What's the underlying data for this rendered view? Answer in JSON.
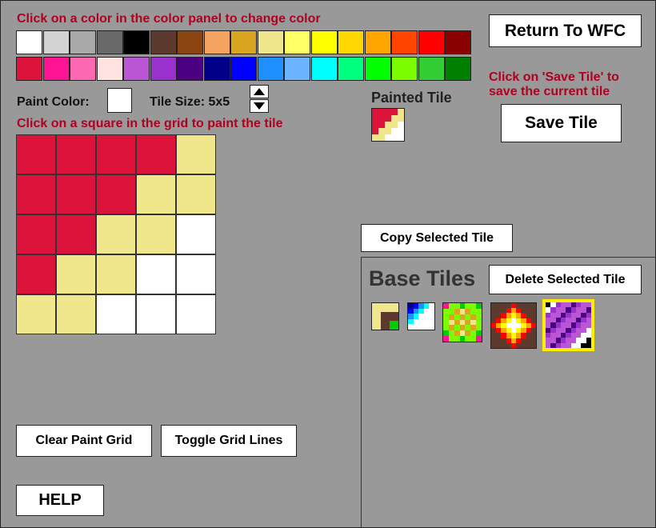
{
  "instructions": {
    "color_panel": "Click on a color in the color panel to change color",
    "grid": "Click on a square in the grid to paint the tile",
    "save": "Click on 'Save Tile' to save the current tile"
  },
  "buttons": {
    "return": "Return To WFC",
    "save_tile": "Save Tile",
    "copy_selected": "Copy Selected Tile",
    "delete_selected": "Delete Selected Tile",
    "clear_grid": "Clear Paint Grid",
    "toggle_grid": "Toggle Grid Lines",
    "help": "HELP"
  },
  "paint_color_label": "Paint Color:",
  "paint_color": "#ffffff",
  "tile_size_label": "Tile Size: 5x5",
  "painted_tile_label": "Painted Tile",
  "base_tiles_label": "Base Tiles",
  "palette_row1": [
    "#ffffff",
    "#d3d3d3",
    "#a9a9a9",
    "#696969",
    "#000000",
    "#5c3a2e",
    "#8b4513",
    "#f4a460",
    "#daa520",
    "#f0e68c",
    "#ffff66",
    "#ffff00",
    "#ffd700",
    "#ffa500",
    "#ff4500",
    "#ff0000",
    "#8b0000"
  ],
  "palette_row2": [
    "#dc143c",
    "#ff1493",
    "#ff69b4",
    "#ffe4e1",
    "#ba55d3",
    "#9932cc",
    "#4b0082",
    "#00008b",
    "#0000ff",
    "#1e90ff",
    "#6cb4ff",
    "#00ffff",
    "#00ff7f",
    "#00ff00",
    "#7cfc00",
    "#32cd32",
    "#008000"
  ],
  "grid": [
    [
      "#dc143c",
      "#dc143c",
      "#dc143c",
      "#dc143c",
      "#f0e68c"
    ],
    [
      "#dc143c",
      "#dc143c",
      "#dc143c",
      "#f0e68c",
      "#f0e68c"
    ],
    [
      "#dc143c",
      "#dc143c",
      "#f0e68c",
      "#f0e68c",
      "#ffffff"
    ],
    [
      "#dc143c",
      "#f0e68c",
      "#f0e68c",
      "#ffffff",
      "#ffffff"
    ],
    [
      "#f0e68c",
      "#f0e68c",
      "#ffffff",
      "#ffffff",
      "#ffffff"
    ]
  ],
  "base_tiles": [
    {
      "name": "tile-brown-green",
      "size": 3,
      "selected": false,
      "pixels": [
        "#f0e68c",
        "#f0e68c",
        "#f0e68c",
        "#f0e68c",
        "#5c3a2e",
        "#5c3a2e",
        "#f0e68c",
        "#5c3a2e",
        "#00cc00"
      ]
    },
    {
      "name": "tile-blue-gradient",
      "size": 5,
      "selected": false,
      "pixels": [
        "#00008b",
        "#0000ff",
        "#1e90ff",
        "#00ffff",
        "#ffffff",
        "#0000ff",
        "#1e90ff",
        "#00ffff",
        "#ffffff",
        "#ffffff",
        "#1e90ff",
        "#00ffff",
        "#ffffff",
        "#ffffff",
        "#ffffff",
        "#00ffff",
        "#ffffff",
        "#ffffff",
        "#ffffff",
        "#ffffff",
        "#ffffff",
        "#ffffff",
        "#ffffff",
        "#ffffff",
        "#ffffff"
      ]
    },
    {
      "name": "tile-green-pattern",
      "size": 7,
      "selected": false,
      "pixels": [
        "#ff1493",
        "#7cfc00",
        "#7cfc00",
        "#00cc00",
        "#7cfc00",
        "#7cfc00",
        "#00cc00",
        "#7cfc00",
        "#7cfc00",
        "#daa520",
        "#f0e68c",
        "#daa520",
        "#7cfc00",
        "#7cfc00",
        "#7cfc00",
        "#daa520",
        "#7cfc00",
        "#daa520",
        "#7cfc00",
        "#daa520",
        "#7cfc00",
        "#7cfc00",
        "#f0e68c",
        "#daa520",
        "#f0e68c",
        "#daa520",
        "#f0e68c",
        "#7cfc00",
        "#7cfc00",
        "#daa520",
        "#7cfc00",
        "#daa520",
        "#7cfc00",
        "#daa520",
        "#7cfc00",
        "#00cc00",
        "#7cfc00",
        "#daa520",
        "#f0e68c",
        "#daa520",
        "#7cfc00",
        "#00cc00",
        "#ff1493",
        "#7cfc00",
        "#7cfc00",
        "#00cc00",
        "#7cfc00",
        "#7cfc00",
        "#ff1493"
      ]
    },
    {
      "name": "tile-fire-diamond",
      "size": 9,
      "selected": false,
      "pixels": [
        "#5c3a2e",
        "#5c3a2e",
        "#5c3a2e",
        "#5c3a2e",
        "#ff0000",
        "#5c3a2e",
        "#5c3a2e",
        "#5c3a2e",
        "#5c3a2e",
        "#5c3a2e",
        "#5c3a2e",
        "#5c3a2e",
        "#ff0000",
        "#ffa500",
        "#ff0000",
        "#5c3a2e",
        "#5c3a2e",
        "#5c3a2e",
        "#5c3a2e",
        "#5c3a2e",
        "#ff0000",
        "#ffa500",
        "#ffff00",
        "#ffa500",
        "#ff0000",
        "#5c3a2e",
        "#5c3a2e",
        "#5c3a2e",
        "#ff0000",
        "#ffa500",
        "#ffff00",
        "#ffffff",
        "#ffff00",
        "#ffa500",
        "#ff0000",
        "#5c3a2e",
        "#ff0000",
        "#ffa500",
        "#ffff00",
        "#ffffff",
        "#ffffff",
        "#ffffff",
        "#ffff00",
        "#ffa500",
        "#ff0000",
        "#5c3a2e",
        "#ff0000",
        "#ffa500",
        "#ffff00",
        "#ffffff",
        "#ffff00",
        "#ffa500",
        "#ff0000",
        "#5c3a2e",
        "#5c3a2e",
        "#5c3a2e",
        "#ff0000",
        "#ffa500",
        "#ffff00",
        "#ffa500",
        "#ff0000",
        "#5c3a2e",
        "#5c3a2e",
        "#5c3a2e",
        "#5c3a2e",
        "#5c3a2e",
        "#ff0000",
        "#ffa500",
        "#ff0000",
        "#5c3a2e",
        "#5c3a2e",
        "#5c3a2e",
        "#5c3a2e",
        "#5c3a2e",
        "#5c3a2e",
        "#5c3a2e",
        "#ff0000",
        "#5c3a2e",
        "#5c3a2e",
        "#5c3a2e",
        "#5c3a2e"
      ]
    },
    {
      "name": "tile-purple-diagonal",
      "size": 9,
      "selected": true,
      "pixels": [
        "#000000",
        "#ffffff",
        "#9932cc",
        "#ba55d3",
        "#ba55d3",
        "#4b0082",
        "#9932cc",
        "#ba55d3",
        "#ba55d3",
        "#ffffff",
        "#9932cc",
        "#ba55d3",
        "#ba55d3",
        "#4b0082",
        "#9932cc",
        "#ba55d3",
        "#ba55d3",
        "#4b0082",
        "#9932cc",
        "#ba55d3",
        "#ba55d3",
        "#4b0082",
        "#9932cc",
        "#ba55d3",
        "#ba55d3",
        "#4b0082",
        "#9932cc",
        "#ba55d3",
        "#ba55d3",
        "#4b0082",
        "#9932cc",
        "#ba55d3",
        "#ba55d3",
        "#4b0082",
        "#9932cc",
        "#ba55d3",
        "#ba55d3",
        "#4b0082",
        "#9932cc",
        "#ba55d3",
        "#ba55d3",
        "#4b0082",
        "#9932cc",
        "#ba55d3",
        "#ba55d3",
        "#4b0082",
        "#9932cc",
        "#ba55d3",
        "#ba55d3",
        "#4b0082",
        "#9932cc",
        "#ba55d3",
        "#ba55d3",
        "#ffffff",
        "#9932cc",
        "#ba55d3",
        "#ba55d3",
        "#4b0082",
        "#9932cc",
        "#ba55d3",
        "#ba55d3",
        "#ffffff",
        "#ffffff",
        "#ba55d3",
        "#ba55d3",
        "#4b0082",
        "#9932cc",
        "#ba55d3",
        "#ba55d3",
        "#ffffff",
        "#ffffff",
        "#000000",
        "#ba55d3",
        "#4b0082",
        "#9932cc",
        "#ba55d3",
        "#ba55d3",
        "#ffffff",
        "#ffffff",
        "#000000",
        "#000000"
      ]
    }
  ],
  "selection_color": "#ffee00"
}
